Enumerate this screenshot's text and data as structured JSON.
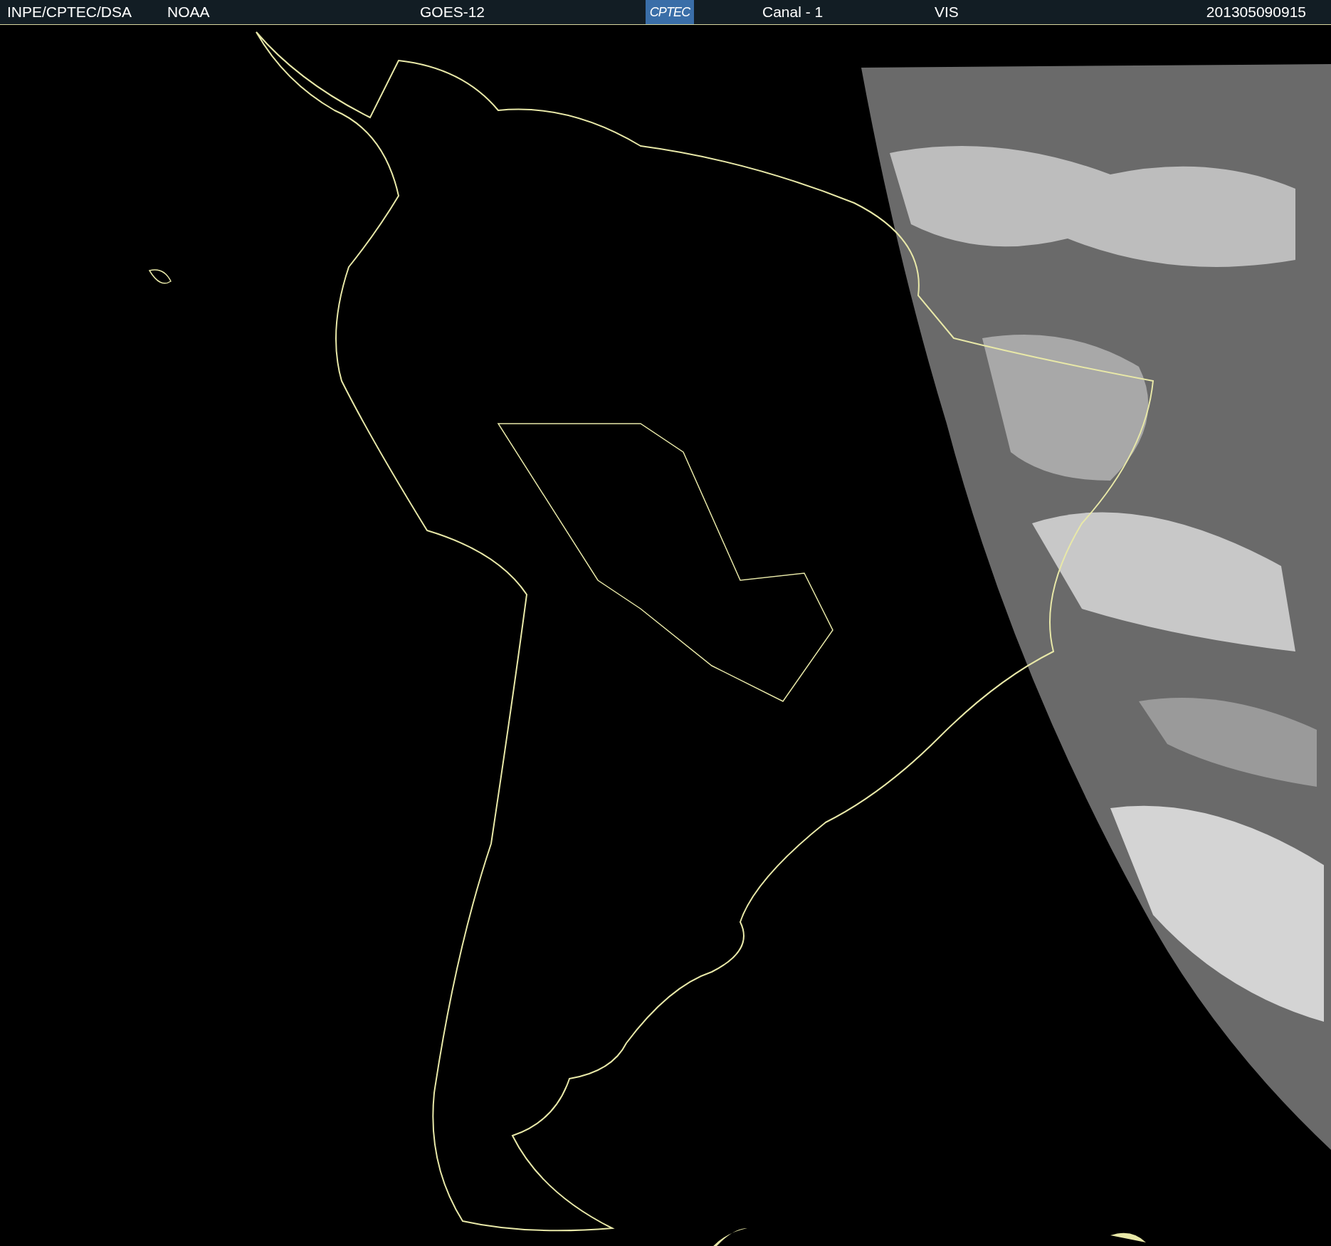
{
  "header": [
    {
      "kind": "text",
      "text": "INPE/CPTEC/DSA"
    },
    {
      "kind": "text",
      "text": "NOAA"
    },
    {
      "kind": "text",
      "text": "GOES-12"
    },
    {
      "kind": "logo",
      "text": "CPTEC"
    },
    {
      "kind": "text",
      "text": "Canal - 1"
    },
    {
      "kind": "text",
      "text": "VIS"
    },
    {
      "kind": "text",
      "text": "201305090915"
    }
  ]
}
